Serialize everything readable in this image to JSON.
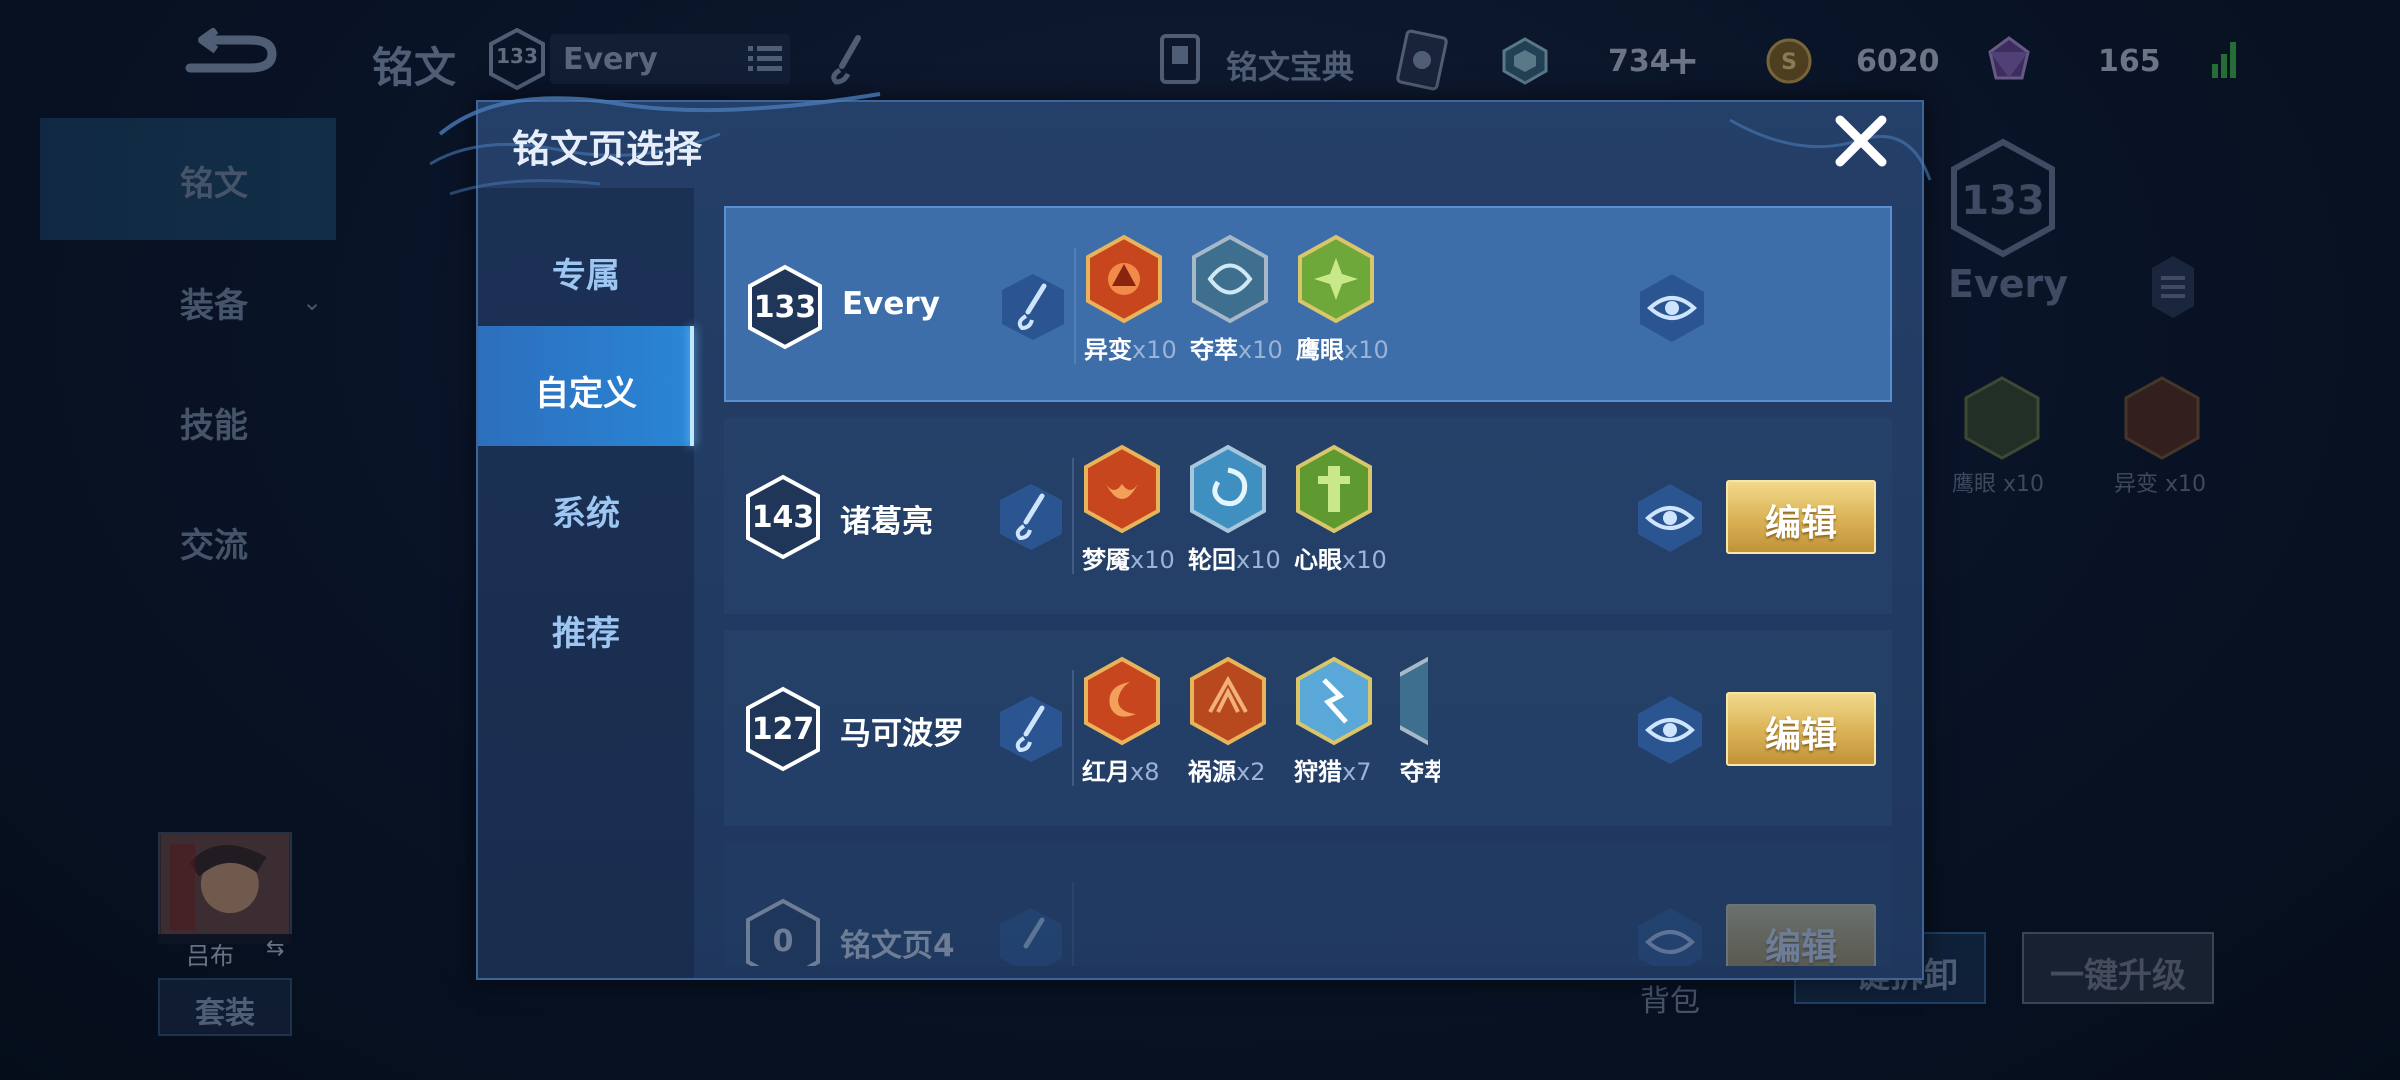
{
  "background": {
    "title": "铭文",
    "current_level": "133",
    "current_page_name": "Every",
    "codex_label": "铭文宝典",
    "currency": {
      "gems": "734",
      "gems_plus": "+",
      "coins": "6020",
      "crystals": "165"
    },
    "sidebar": [
      {
        "label": "铭文"
      },
      {
        "label": "装备"
      },
      {
        "label": "技能"
      },
      {
        "label": "交流"
      }
    ],
    "right_panel": {
      "level": "133",
      "name": "Every",
      "runes": [
        {
          "name": "鹰眼",
          "count": "x10"
        },
        {
          "name": "异变",
          "count": "x10"
        }
      ]
    },
    "hero_name": "吕布",
    "hero_swap": "⇆",
    "suit_button": "套装",
    "bag_label": "背包",
    "unload_button": "一键拆卸",
    "upgrade_button": "一键升级"
  },
  "modal": {
    "title": "铭文页选择",
    "categories": [
      {
        "label": "专属",
        "active": false
      },
      {
        "label": "自定义",
        "active": true
      },
      {
        "label": "系统",
        "active": false
      },
      {
        "label": "推荐",
        "active": false
      }
    ],
    "pages": [
      {
        "level": "133",
        "name": "Every",
        "selected": true,
        "edit_label": "",
        "runes": [
          {
            "name": "异变",
            "count": "x10",
            "color": "red"
          },
          {
            "name": "夺萃",
            "count": "x10",
            "color": "blue"
          },
          {
            "name": "鹰眼",
            "count": "x10",
            "color": "green"
          }
        ]
      },
      {
        "level": "143",
        "name": "诸葛亮",
        "selected": false,
        "edit_label": "编辑",
        "runes": [
          {
            "name": "梦魇",
            "count": "x10",
            "color": "red"
          },
          {
            "name": "轮回",
            "count": "x10",
            "color": "blue"
          },
          {
            "name": "心眼",
            "count": "x10",
            "color": "green"
          }
        ]
      },
      {
        "level": "127",
        "name": "马可波罗",
        "selected": false,
        "edit_label": "编辑",
        "runes": [
          {
            "name": "红月",
            "count": "x8",
            "color": "red"
          },
          {
            "name": "祸源",
            "count": "x2",
            "color": "red"
          },
          {
            "name": "狩猎",
            "count": "x7",
            "color": "blue"
          },
          {
            "name": "夺萃",
            "count": "",
            "color": "blue"
          }
        ]
      },
      {
        "level": "0",
        "name": "铭文页4",
        "selected": false,
        "edit_label": "编辑",
        "runes": []
      }
    ]
  },
  "colors": {
    "accent_blue": "#2a86d6",
    "selected_row": "#3d6eaa",
    "edit_gold": "#d9b154",
    "rune_red": "#c8461e",
    "rune_blue": "#5aa8d8",
    "rune_green": "#6fa83a"
  }
}
